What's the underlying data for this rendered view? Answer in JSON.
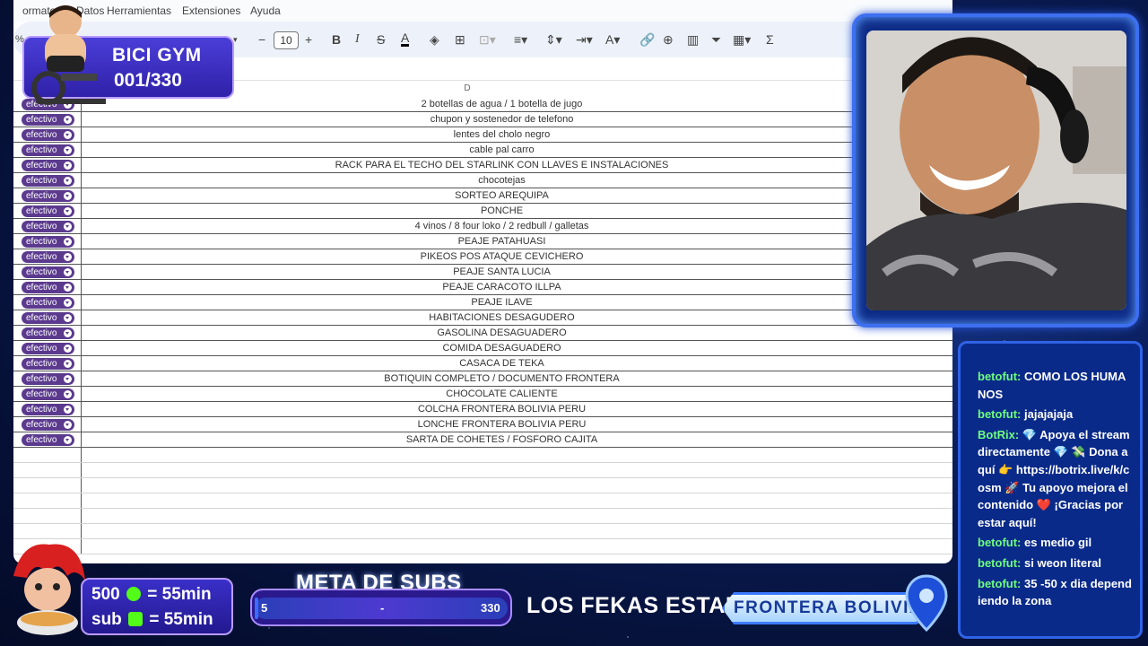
{
  "sheet": {
    "menu_items": [
      "ormato",
      "Datos",
      "Herramientas",
      "Extensiones",
      "Ayuda"
    ],
    "toolbar": {
      "zoom_fragment": "%",
      "font_size": "10",
      "buttons": [
        "decrease-font",
        "increase-font",
        "bold",
        "italic",
        "strikethrough",
        "text-color",
        "fill-color",
        "borders",
        "merge",
        "align",
        "valign",
        "wrap",
        "rotate",
        "link",
        "comment",
        "chart",
        "filter",
        "filter-views",
        "functions"
      ]
    },
    "column_header": "D",
    "rows": [
      {
        "status": "efectivo",
        "item": "2 botellas de agua / 1 botella de jugo"
      },
      {
        "status": "efectivo",
        "item": "chupon y sostenedor de telefono"
      },
      {
        "status": "efectivo",
        "item": "lentes del cholo negro"
      },
      {
        "status": "efectivo",
        "item": "cable pal carro"
      },
      {
        "status": "efectivo",
        "item": "RACK PARA EL TECHO DEL STARLINK CON LLAVES E INSTALACIONES"
      },
      {
        "status": "efectivo",
        "item": "chocotejas"
      },
      {
        "status": "efectivo",
        "item": "SORTEO AREQUIPA"
      },
      {
        "status": "efectivo",
        "item": "PONCHE"
      },
      {
        "status": "efectivo",
        "item": "4 vinos / 8 four loko / 2 redbull / galletas"
      },
      {
        "status": "efectivo",
        "item": "PEAJE PATAHUASI"
      },
      {
        "status": "efectivo",
        "item": "PIKEOS POS ATAQUE CEVICHERO"
      },
      {
        "status": "efectivo",
        "item": "PEAJE SANTA LUCIA"
      },
      {
        "status": "efectivo",
        "item": "PEAJE CARACOTO ILLPA"
      },
      {
        "status": "efectivo",
        "item": "PEAJE ILAVE"
      },
      {
        "status": "efectivo",
        "item": "HABITACIONES DESAGUDERO"
      },
      {
        "status": "efectivo",
        "item": "GASOLINA DESAGUADERO"
      },
      {
        "status": "efectivo",
        "item": "COMIDA DESAGUADERO"
      },
      {
        "status": "efectivo",
        "item": "CASACA DE TEKA"
      },
      {
        "status": "efectivo",
        "item": "BOTIQUIN COMPLETO / DOCUMENTO FRONTERA"
      },
      {
        "status": "efectivo",
        "item": "CHOCOLATE CALIENTE"
      },
      {
        "status": "efectivo",
        "item": "COLCHA FRONTERA BOLIVIA PERU"
      },
      {
        "status": "efectivo",
        "item": "LONCHE FRONTERA BOLIVIA PERU"
      },
      {
        "status": "efectivo",
        "item": "SARTA DE COHETES / FOSFORO CAJITA"
      }
    ],
    "empty_rows": 7
  },
  "gym": {
    "title": "BICI GYM",
    "count": "001/330"
  },
  "chat": {
    "messages": [
      {
        "user": "betofut:",
        "text": "COMO LOS HUMANOS"
      },
      {
        "user": "betofut:",
        "text": "jajajajaja"
      },
      {
        "user": "BotRix:",
        "text": "💎 Apoya el stream directamente 💎 💸 Dona aquí 👉 https://botrix.live/k/cosm 🚀 Tu apoyo mejora el contenido ❤️ ¡Gracias por estar aquí!"
      },
      {
        "user": "betofut:",
        "text": "es medio gil"
      },
      {
        "user": "betofut:",
        "text": "si weon literal"
      },
      {
        "user": "betofut:",
        "text": "35 -50 x dia dependiendo la zona"
      }
    ]
  },
  "subs": {
    "line1_amount": "500",
    "line1_value": "= 55min",
    "line2_label": "sub",
    "line2_value": "= 55min"
  },
  "meta": {
    "title": "META DE SUBS",
    "current": "5",
    "mid": "-",
    "goal": "330",
    "progress": 0.015
  },
  "location": {
    "label": "LOS FEKAS ESTAN EN:",
    "place": "FRONTERA BOLIVIA"
  },
  "colors": {
    "chip": "#5b3a8e",
    "chat_user": "#6dff7c",
    "accent": "#3d6ff0"
  }
}
